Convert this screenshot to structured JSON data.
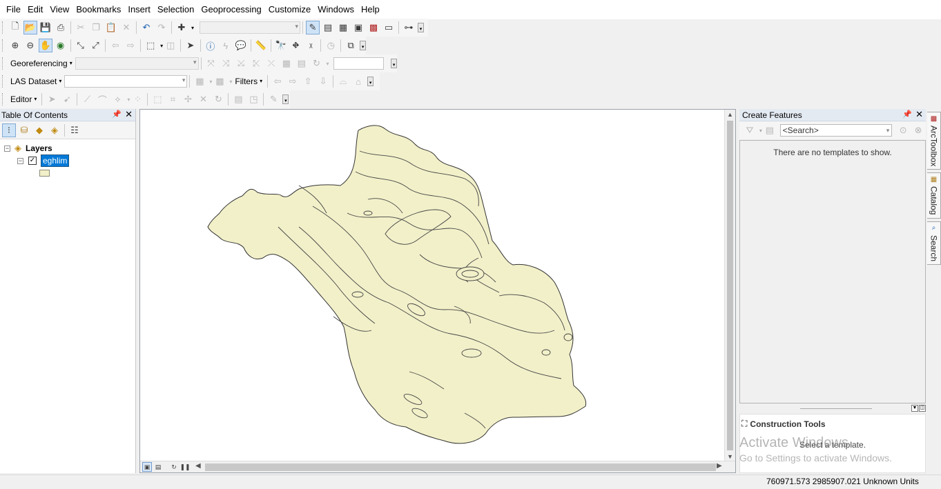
{
  "menu": [
    "File",
    "Edit",
    "View",
    "Bookmarks",
    "Insert",
    "Selection",
    "Geoprocessing",
    "Customize",
    "Windows",
    "Help"
  ],
  "toolbars": {
    "georeferencing_label": "Georeferencing",
    "las_dataset_label": "LAS Dataset",
    "filters_label": "Filters",
    "editor_label": "Editor"
  },
  "toc": {
    "title": "Table Of Contents",
    "root_label": "Layers",
    "layer_name": "eghlim",
    "layer_checked": true,
    "layer_fill": "#f2f0c9"
  },
  "create_features": {
    "title": "Create Features",
    "search_placeholder": "<Search>",
    "empty_message": "There are no templates to show.",
    "construction_title": "Construction Tools",
    "construction_hint": "Select a template."
  },
  "side_tabs": [
    "ArcToolbox",
    "Catalog",
    "Search"
  ],
  "watermark": {
    "line1": "Activate Windows",
    "line2": "Go to Settings to activate Windows."
  },
  "status": {
    "coordinates": "760971.573  2985907.021 Unknown Units"
  },
  "colors": {
    "polygon_fill": "#f2f0c9",
    "polygon_stroke": "#333333",
    "selection": "#0078d7"
  }
}
